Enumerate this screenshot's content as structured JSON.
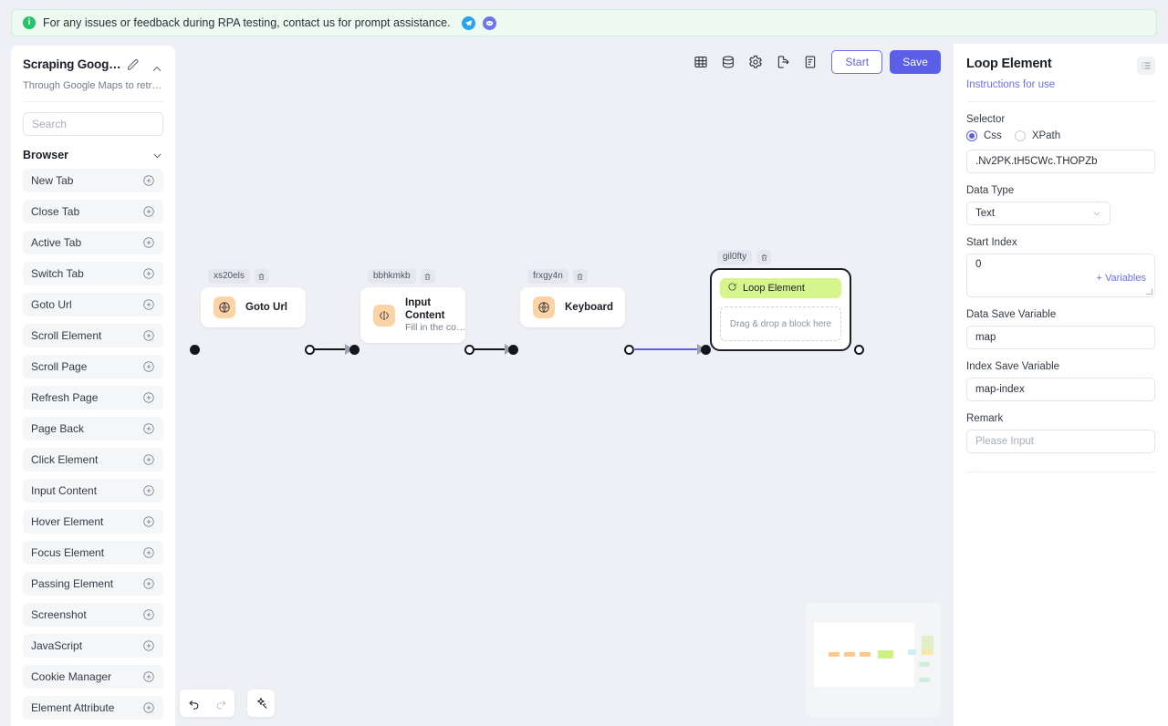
{
  "banner": {
    "icon": "info-icon",
    "text": "For any issues or feedback during RPA testing, contact us for prompt assistance.",
    "telegram_icon": "telegram-icon",
    "discord_icon": "discord-icon"
  },
  "left_panel": {
    "title": "Scraping Google…",
    "subtitle": "Through Google Maps to retr…",
    "edit_icon": "pencil-icon",
    "collapse_icon": "chevron-up-icon",
    "search_placeholder": "Search",
    "group": {
      "label": "Browser",
      "chevron_icon": "chevron-down-icon"
    },
    "items": [
      {
        "label": "New Tab"
      },
      {
        "label": "Close Tab"
      },
      {
        "label": "Active Tab"
      },
      {
        "label": "Switch Tab"
      },
      {
        "label": "Goto Url"
      },
      {
        "label": "Scroll Element"
      },
      {
        "label": "Scroll Page"
      },
      {
        "label": "Refresh Page"
      },
      {
        "label": "Page Back"
      },
      {
        "label": "Click Element"
      },
      {
        "label": "Input Content"
      },
      {
        "label": "Hover Element"
      },
      {
        "label": "Focus Element"
      },
      {
        "label": "Passing Element"
      },
      {
        "label": "Screenshot"
      },
      {
        "label": "JavaScript"
      },
      {
        "label": "Cookie Manager"
      },
      {
        "label": "Element Attribute"
      }
    ],
    "add_icon": "plus-circle-icon"
  },
  "toolbar": {
    "icons": [
      "table-icon",
      "database-icon",
      "gear-icon",
      "export-icon",
      "log-icon"
    ],
    "start_label": "Start",
    "save_label": "Save",
    "accent_color": "#5b5fe8"
  },
  "canvas": {
    "nodes": [
      {
        "id": "xs20els",
        "title": "Goto Url",
        "subtitle": "",
        "icon": "globe-icon"
      },
      {
        "id": "bbhkmkb",
        "title": "Input Content",
        "subtitle": "Fill in the cont…",
        "icon": "input-icon"
      },
      {
        "id": "frxgy4n",
        "title": "Keyboard",
        "subtitle": "",
        "icon": "globe-icon"
      }
    ],
    "loop_node": {
      "id": "gil0fty",
      "header_label": "Loop Element",
      "header_icon": "loop-icon",
      "dropzone_label": "Drag & drop a block here",
      "header_color": "#d6f58c"
    },
    "delete_icon": "trash-icon",
    "controls": {
      "undo_icon": "undo-icon",
      "redo_icon": "redo-icon",
      "auto_layout_icon": "magic-wand-icon"
    },
    "minimap": {
      "name": "minimap",
      "node_colors": [
        "#fbc98f",
        "#fbc98f",
        "#fbc98f",
        "#cdf27f",
        "#cdeef5",
        "#dff0c4",
        "#f7e7a8",
        "#cfeedd",
        "#cfeedd"
      ]
    }
  },
  "right_panel": {
    "title": "Loop Element",
    "menu_icon": "list-indent-icon",
    "instructions_link": "Instructions for use",
    "selector": {
      "label": "Selector",
      "options": [
        {
          "label": "Css",
          "selected": true
        },
        {
          "label": "XPath",
          "selected": false
        }
      ],
      "value": ".Nv2PK.tH5CWc.THOPZb"
    },
    "data_type": {
      "label": "Data Type",
      "value": "Text",
      "chevron_icon": "chevron-down-icon"
    },
    "start_index": {
      "label": "Start Index",
      "value": "0",
      "variables_link": "+ Variables"
    },
    "data_save_variable": {
      "label": "Data Save Variable",
      "value": "map"
    },
    "index_save_variable": {
      "label": "Index Save Variable",
      "value": "map-index"
    },
    "remark": {
      "label": "Remark",
      "value": "",
      "placeholder": "Please Input"
    }
  }
}
